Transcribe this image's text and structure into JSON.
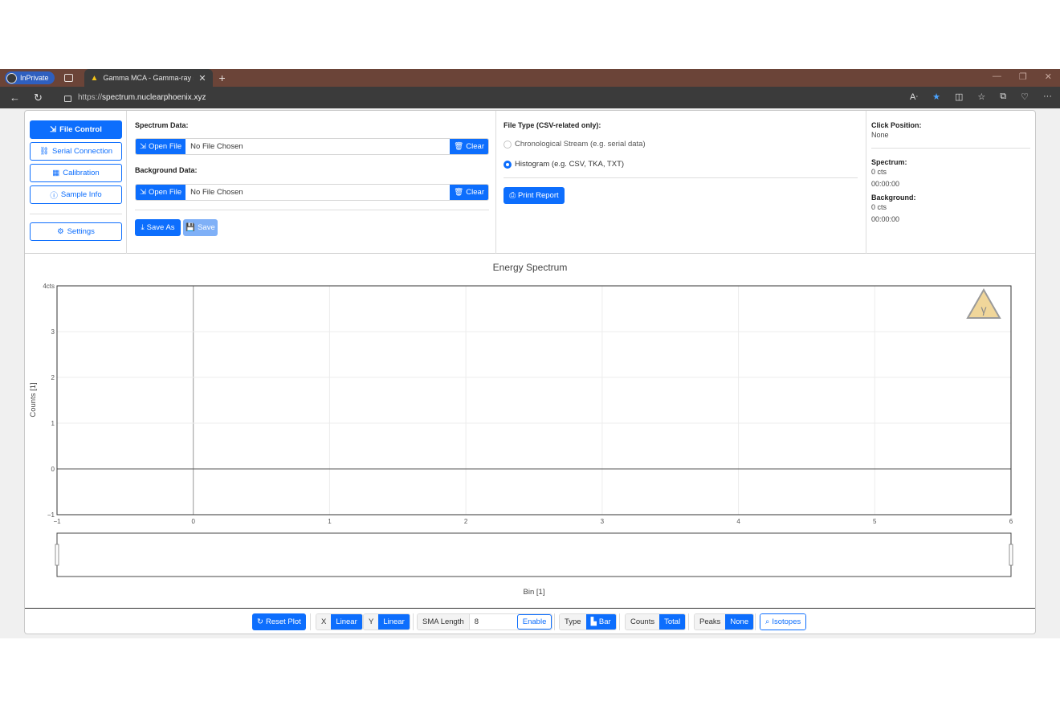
{
  "browser": {
    "inprivate_label": "InPrivate",
    "tab_title": "Gamma MCA - Gamma-ray spec",
    "url_scheme": "https://",
    "url_host": "spectrum.nuclearphoenix.xyz"
  },
  "nav": {
    "file_control": "File Control",
    "serial_connection": "Serial Connection",
    "calibration": "Calibration",
    "sample_info": "Sample Info",
    "settings": "Settings"
  },
  "spectrum": {
    "spectrum_label": "Spectrum Data:",
    "background_label": "Background Data:",
    "open_file": "Open File",
    "no_file": "No File Chosen",
    "clear": "Clear",
    "save_as": "Save As",
    "save": "Save"
  },
  "filetype": {
    "label": "File Type (CSV-related only):",
    "option_stream": "Chronological Stream (e.g. serial data)",
    "option_histogram": "Histogram (e.g. CSV, TKA, TXT)",
    "selected": "Histogram (e.g. CSV, TKA, TXT)",
    "print_report": "Print Report"
  },
  "info": {
    "click_title": "Click Position:",
    "click_value": "None",
    "spectrum_title": "Spectrum:",
    "spectrum_counts": "0 cts",
    "spectrum_time": "00:00:00",
    "background_title": "Background:",
    "background_counts": "0 cts",
    "background_time": "00:00:00"
  },
  "toolbar": {
    "reset_plot": "Reset Plot",
    "x_label": "X",
    "x_value": "Linear",
    "y_label": "Y",
    "y_value": "Linear",
    "sma_label": "SMA Length",
    "sma_value": "8",
    "enable": "Enable",
    "type_label": "Type",
    "type_value": "Bar",
    "counts_label": "Counts",
    "counts_value": "Total",
    "peaks_label": "Peaks",
    "peaks_value": "None",
    "isotopes": "Isotopes"
  },
  "chart_data": {
    "type": "bar",
    "title": "Energy Spectrum",
    "xlabel": "Bin [1]",
    "ylabel": "Counts [1]",
    "xlim": [
      -1,
      6
    ],
    "ylim": [
      -1,
      4
    ],
    "x_ticks": [
      "−1",
      "0",
      "1",
      "2",
      "3",
      "4",
      "5",
      "6"
    ],
    "y_ticks": [
      "−1",
      "0",
      "1",
      "2",
      "3",
      "4cts"
    ],
    "series": [],
    "grid": true
  },
  "colors": {
    "accent": "#0d6efd",
    "logo_fill": "#f0d69a"
  }
}
